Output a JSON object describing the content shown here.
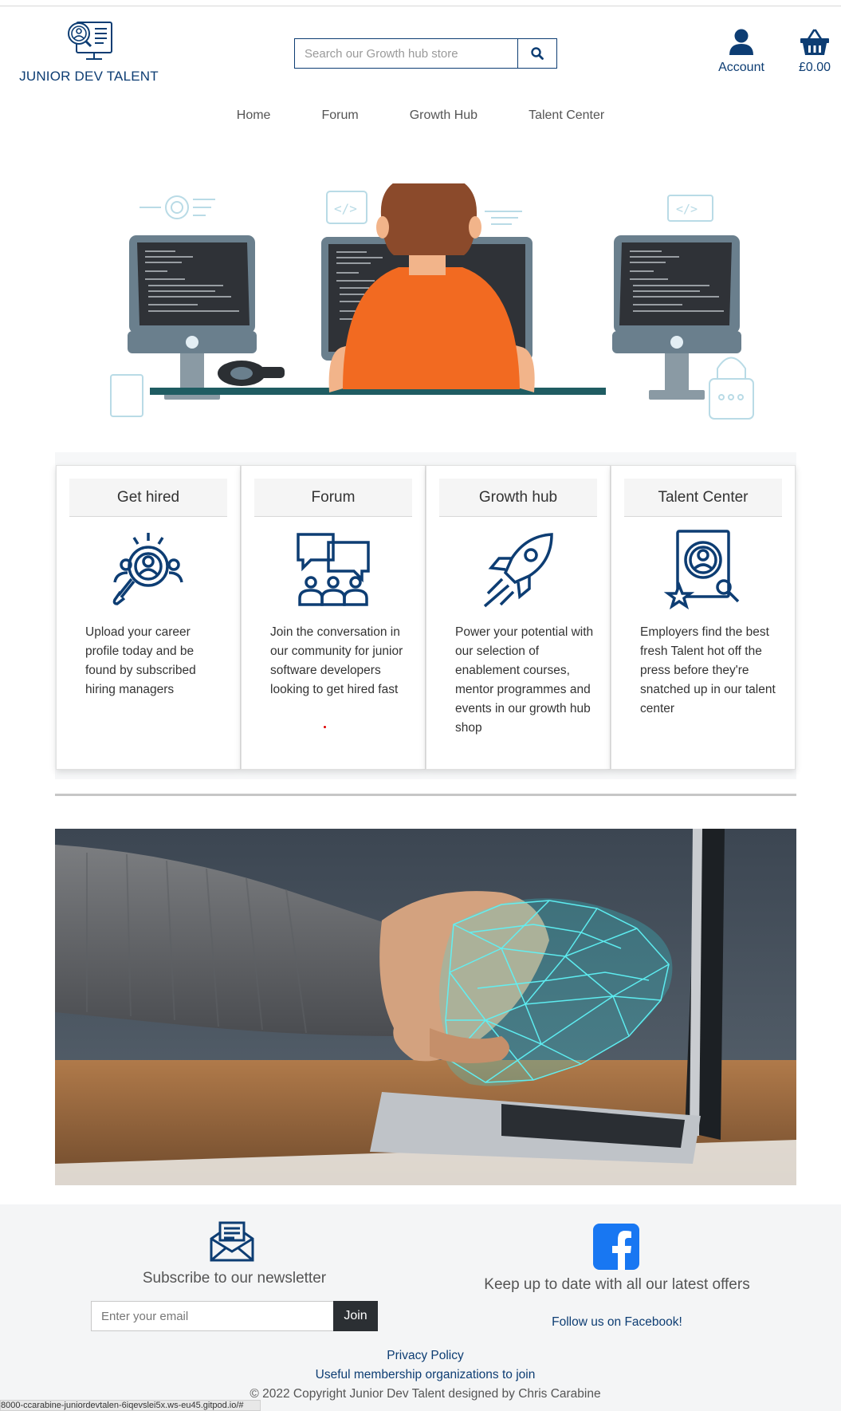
{
  "brand": {
    "name": "JUNIOR DEV TALENT",
    "color": "#0d3d73"
  },
  "search": {
    "placeholder": "Search our Growth hub store"
  },
  "header": {
    "account_label": "Account",
    "cart_total": "£0.00"
  },
  "nav": {
    "items": [
      "Home",
      "Forum",
      "Growth Hub",
      "Talent Center"
    ]
  },
  "cards": [
    {
      "title": "Get hired",
      "icon": "search-person-icon",
      "text": "Upload your career profile today and be found by subscribed hiring managers"
    },
    {
      "title": "Forum",
      "icon": "chat-group-icon",
      "text": "Join the conversation in our community for junior software developers looking to get hired fast"
    },
    {
      "title": "Growth hub",
      "icon": "rocket-icon",
      "text": "Power your potential with our selection of enablement courses, mentor programmes and events in our growth hub shop"
    },
    {
      "title": "Talent Center",
      "icon": "profile-star-icon",
      "text": "Employers find the best fresh Talent hot off the press before they're snatched up in our talent center"
    }
  ],
  "footer": {
    "newsletter_title": "Subscribe to our newsletter",
    "email_placeholder": "Enter your email",
    "join_label": "Join",
    "facebook_title": "Keep up to date with all our latest offers",
    "facebook_link": "Follow us on Facebook!",
    "privacy": "Privacy Policy",
    "membership": "Useful membership organizations to join",
    "copyright": "© 2022 Copyright Junior Dev Talent designed by Chris Carabine"
  },
  "status_bar": {
    "url": "8000-ccarabine-juniordevtalen-6iqevslei5x.ws-eu45.gitpod.io/#"
  },
  "colors": {
    "accent": "#0d3d73",
    "facebook": "#1877f2",
    "hero_shirt": "#f26a21",
    "join_button": "#2b2f33"
  }
}
